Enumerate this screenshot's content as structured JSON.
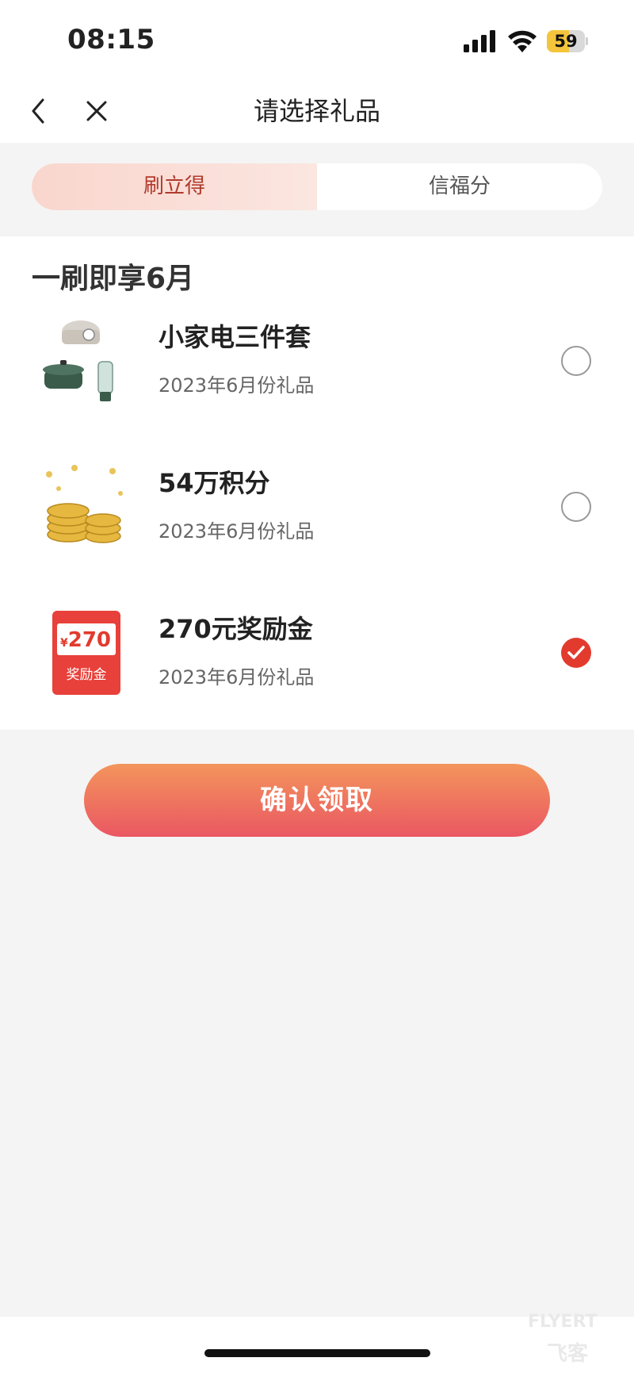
{
  "status_bar": {
    "time": "08:15",
    "battery": "59",
    "battery_level": 0.59
  },
  "nav": {
    "title": "请选择礼品"
  },
  "tabs": [
    {
      "label": "刷立得",
      "active": true
    },
    {
      "label": "信福分",
      "active": false
    }
  ],
  "section": {
    "title": "一刷即享6月"
  },
  "gifts": [
    {
      "name": "小家电三件套",
      "subtitle": "2023年6月份礼品",
      "selected": false,
      "icon": "appliance-set-image"
    },
    {
      "name": "54万积分",
      "subtitle": "2023年6月份礼品",
      "selected": false,
      "icon": "gold-coins-image"
    },
    {
      "name": "270元奖励金",
      "subtitle": "2023年6月份礼品",
      "selected": true,
      "icon": "reward-coupon-image",
      "coupon": {
        "symbol": "¥",
        "amount": "270",
        "label": "奖励金"
      }
    }
  ],
  "confirm_button": {
    "label": "确认领取"
  },
  "watermark": {
    "line1": "FLYERT",
    "line2": "飞客"
  },
  "colors": {
    "accent": "#e23b2e",
    "tab_active_text": "#b13a2d",
    "button_top": "#f3955c",
    "button_bottom": "#ea5762"
  }
}
